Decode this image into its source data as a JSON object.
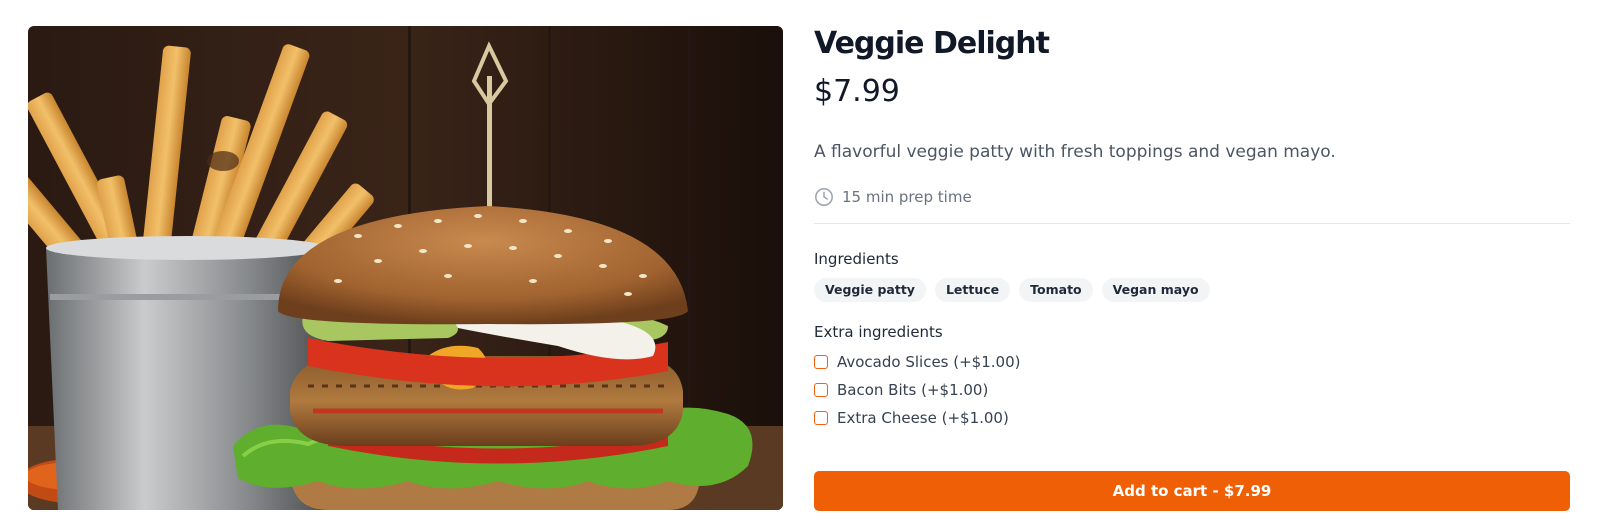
{
  "product": {
    "name": "Veggie Delight",
    "price": "$7.99",
    "description": "A flavorful veggie patty with fresh toppings and vegan mayo.",
    "prep_time": "15 min prep time",
    "image_alt": "Veggie burger with fries"
  },
  "ingredients": {
    "label": "Ingredients",
    "items": [
      "Veggie patty",
      "Lettuce",
      "Tomato",
      "Vegan mayo"
    ]
  },
  "extras": {
    "label": "Extra ingredients",
    "items": [
      {
        "label": "Avocado Slices (+$1.00)",
        "checked": false
      },
      {
        "label": "Bacon Bits (+$1.00)",
        "checked": false
      },
      {
        "label": "Extra Cheese (+$1.00)",
        "checked": false
      }
    ]
  },
  "cart": {
    "button_label": "Add to cart - $7.99"
  },
  "colors": {
    "accent": "#ef6006",
    "title": "#111827",
    "chip_bg": "#f3f4f6",
    "divider": "#e5e7eb"
  },
  "icons": {
    "prep": "clock-icon",
    "checkbox": "checkbox-icon"
  }
}
